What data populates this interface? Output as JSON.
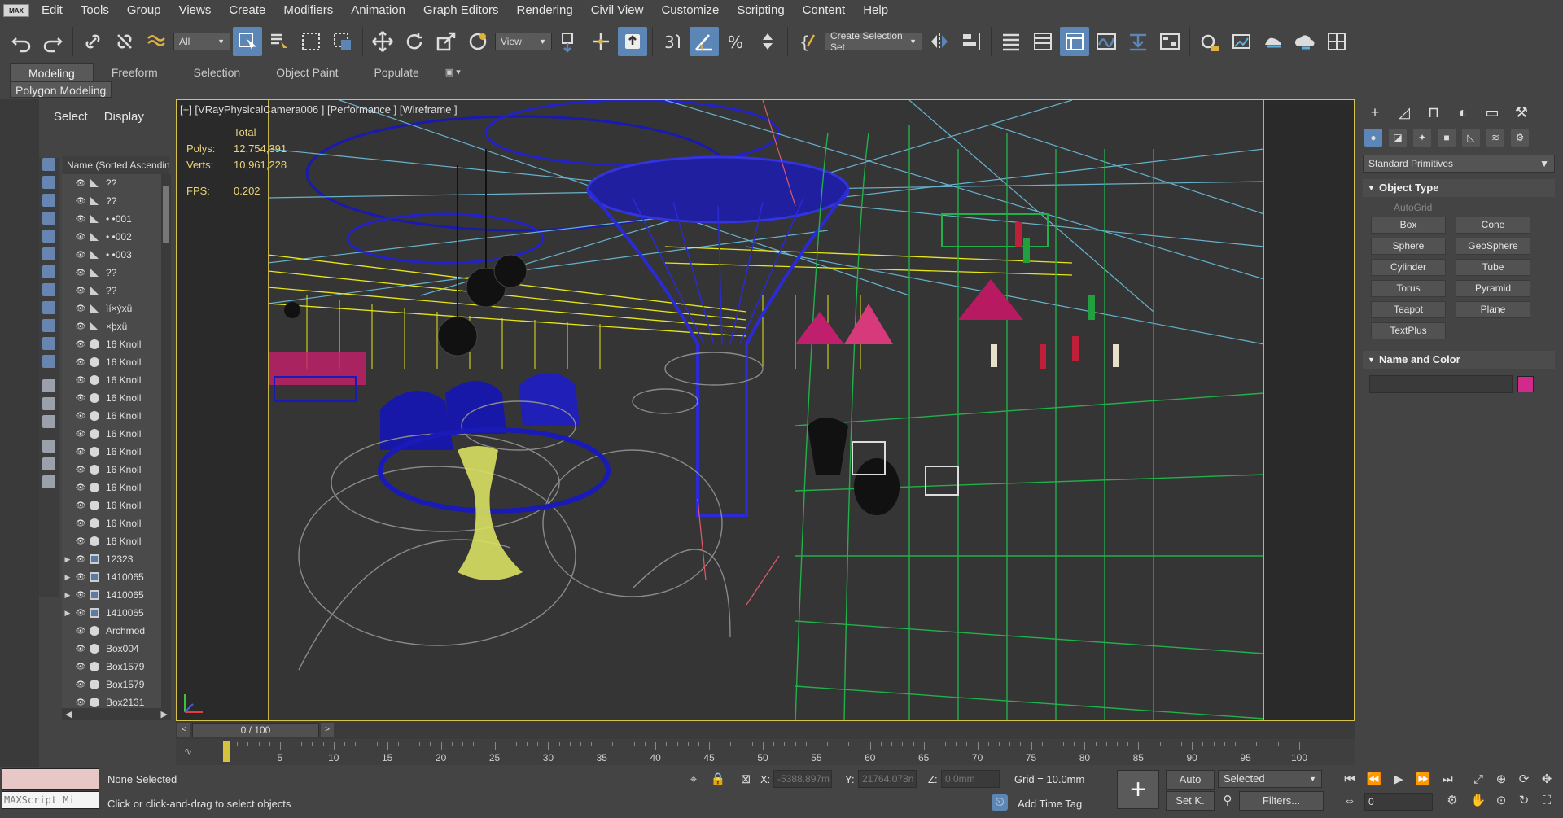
{
  "app": {
    "logo": "MAX"
  },
  "menu": [
    "Edit",
    "Tools",
    "Group",
    "Views",
    "Create",
    "Modifiers",
    "Animation",
    "Graph Editors",
    "Rendering",
    "Civil View",
    "Customize",
    "Scripting",
    "Content",
    "Help"
  ],
  "toolbar": {
    "filter_dropdown": "All",
    "refcoord_dropdown": "View",
    "selection_set": "Create Selection Set"
  },
  "ribbon": {
    "tabs": [
      "Modeling",
      "Freeform",
      "Selection",
      "Object Paint",
      "Populate"
    ],
    "active_tab": "Modeling",
    "subpanel": "Polygon Modeling"
  },
  "explorer": {
    "tabs": [
      "Select",
      "Display"
    ],
    "column_header": "Name (Sorted Ascending)",
    "rows": [
      {
        "name": "??",
        "type": "tri"
      },
      {
        "name": "??",
        "type": "tri"
      },
      {
        "name": "• •001",
        "type": "tri"
      },
      {
        "name": "• •002",
        "type": "tri"
      },
      {
        "name": "• •003",
        "type": "tri"
      },
      {
        "name": "??",
        "type": "tri"
      },
      {
        "name": "??",
        "type": "tri"
      },
      {
        "name": "ìí×ýxü",
        "type": "tri"
      },
      {
        "name": "×þxü",
        "type": "tri"
      },
      {
        "name": "16 Knoll",
        "type": "dot"
      },
      {
        "name": "16 Knoll",
        "type": "dot"
      },
      {
        "name": "16 Knoll",
        "type": "dot"
      },
      {
        "name": "16 Knoll",
        "type": "dot"
      },
      {
        "name": "16 Knoll",
        "type": "dot"
      },
      {
        "name": "16 Knoll",
        "type": "dot"
      },
      {
        "name": "16 Knoll",
        "type": "dot"
      },
      {
        "name": "16 Knoll",
        "type": "dot"
      },
      {
        "name": "16 Knoll",
        "type": "dot"
      },
      {
        "name": "16 Knoll",
        "type": "dot"
      },
      {
        "name": "16 Knoll",
        "type": "dot"
      },
      {
        "name": "16 Knoll",
        "type": "dot"
      },
      {
        "name": "12323",
        "type": "grp"
      },
      {
        "name": "1410065",
        "type": "grp"
      },
      {
        "name": "1410065",
        "type": "grp"
      },
      {
        "name": "1410065",
        "type": "grp"
      },
      {
        "name": "Archmod",
        "type": "dot"
      },
      {
        "name": "Box004",
        "type": "dot"
      },
      {
        "name": "Box1579",
        "type": "dot"
      },
      {
        "name": "Box1579",
        "type": "dot"
      },
      {
        "name": "Box2131",
        "type": "dot"
      }
    ]
  },
  "viewport": {
    "label": "[+] [VRayPhysicalCamera006 ] [Performance ] [Wireframe ]",
    "stats": {
      "total_label": "Total",
      "polys_label": "Polys:",
      "polys": "12,754,391",
      "verts_label": "Verts:",
      "verts": "10,961,228",
      "fps_label": "FPS:",
      "fps": "0.202"
    }
  },
  "command_panel": {
    "category": "Standard Primitives",
    "object_type_title": "Object Type",
    "autogrid": "AutoGrid",
    "primitives": [
      "Box",
      "Cone",
      "Sphere",
      "GeoSphere",
      "Cylinder",
      "Tube",
      "Torus",
      "Pyramid",
      "Teapot",
      "Plane",
      "TextPlus"
    ],
    "name_color_title": "Name and Color",
    "swatch_color": "#d12a8c"
  },
  "timeline": {
    "slider": "0 / 100",
    "ticks": [
      0,
      5,
      10,
      15,
      20,
      25,
      30,
      35,
      40,
      45,
      50,
      55,
      60,
      65,
      70,
      75,
      80,
      85,
      90,
      95,
      100
    ]
  },
  "status": {
    "maxscript_placeholder": "MAXScript Mi",
    "selection": "None Selected",
    "prompt": "Click or click-and-drag to select objects",
    "x_label": "X:",
    "x": "-5388.897m",
    "y_label": "Y:",
    "y": "21764.078n",
    "z_label": "Z:",
    "z": "0.0mm",
    "grid": "Grid = 10.0mm",
    "add_time_tag": "Add Time Tag",
    "auto_btn": "Auto",
    "setk_btn": "Set K.",
    "key_mode": "Selected",
    "filters": "Filters...",
    "frame": "0"
  },
  "colors": {
    "accent": "#5b86b5",
    "viewport_border": "#d7c24a",
    "stats_text": "#e8d37a"
  }
}
